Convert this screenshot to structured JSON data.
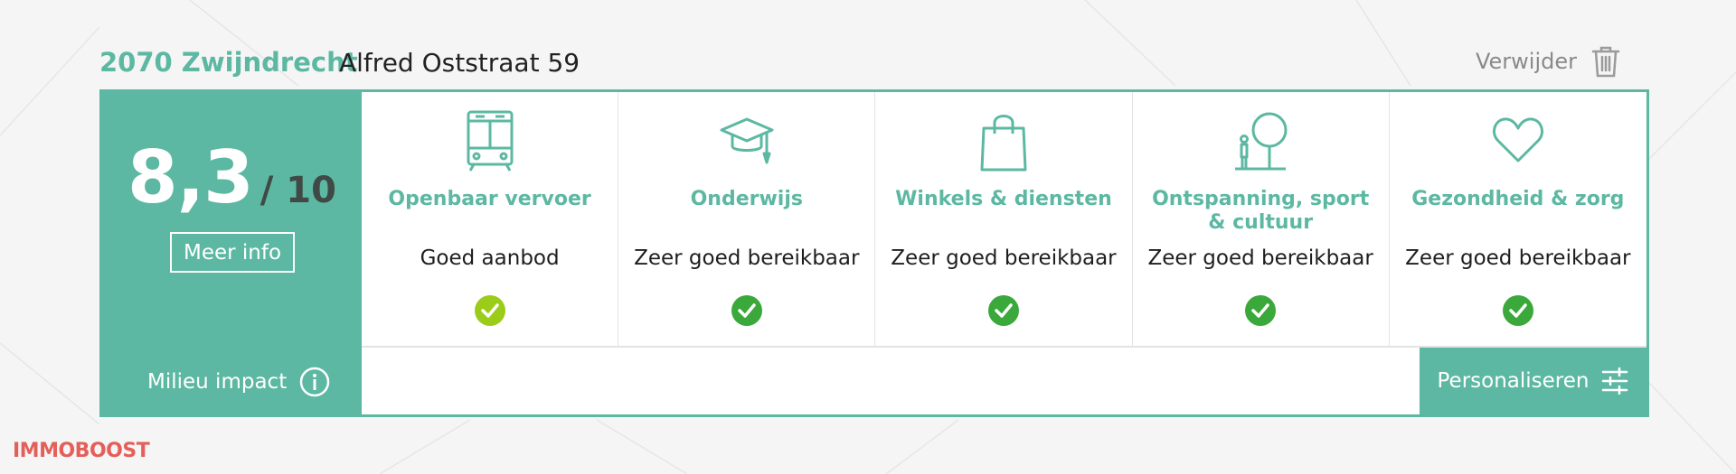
{
  "header": {
    "city": "2070 Zwijndrecht",
    "street": "Alfred Oststraat 59",
    "remove_label": "Verwijder"
  },
  "score": {
    "value": "8,3",
    "max": "/ 10",
    "more_info_label": "Meer info",
    "milieu_label": "Milieu impact"
  },
  "categories": [
    {
      "title": "Openbaar vervoer",
      "status": "Goed aanbod",
      "icon": "bus-icon",
      "check_color": "#9ccc1a"
    },
    {
      "title": "Onderwijs",
      "status": "Zeer goed bereikbaar",
      "icon": "graduation-cap-icon",
      "check_color": "#3aa83a"
    },
    {
      "title": "Winkels & diensten",
      "status": "Zeer goed bereikbaar",
      "icon": "shopping-bag-icon",
      "check_color": "#3aa83a"
    },
    {
      "title": "Ontspanning, sport & cultuur",
      "status": "Zeer goed bereikbaar",
      "icon": "park-tree-icon",
      "check_color": "#3aa83a"
    },
    {
      "title": "Gezondheid & zorg",
      "status": "Zeer goed bereikbaar",
      "icon": "heart-icon",
      "check_color": "#3aa83a"
    }
  ],
  "personalize_label": "Personaliseren",
  "watermark": "IMMOBOOST",
  "colors": {
    "accent": "#5cb8a2",
    "check_good": "#3aa83a",
    "check_ok": "#9ccc1a",
    "watermark": "#e2453f"
  }
}
